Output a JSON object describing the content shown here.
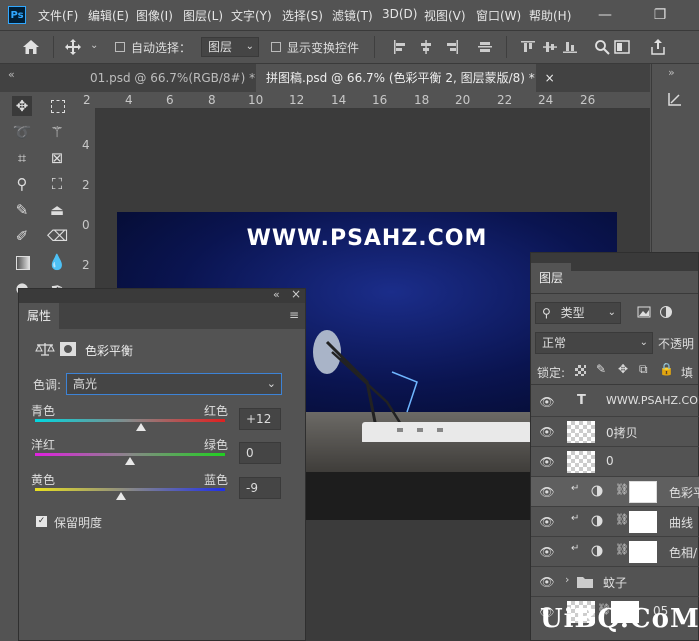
{
  "menubar": {
    "logo": "Ps",
    "items": [
      "文件(F)",
      "编辑(E)",
      "图像(I)",
      "图层(L)",
      "文字(Y)",
      "选择(S)",
      "滤镜(T)",
      "3D(D)",
      "视图(V)",
      "窗口(W)",
      "帮助(H)"
    ],
    "minimize": "—",
    "restore": "❐"
  },
  "options": {
    "auto_select_label": "自动选择：",
    "auto_select_value": "图层",
    "show_transform_label": "显示变换控件"
  },
  "tabs": [
    {
      "label": "01.psd @ 66.7%(RGB/8#) *",
      "close": "×"
    },
    {
      "label": "拼图稿.psd @ 66.7% (色彩平衡 2, 图层蒙版/8) *",
      "close": "×"
    }
  ],
  "tab_menu": "«",
  "ruler": {
    "top": [
      "2",
      "4",
      "6",
      "8",
      "10",
      "12",
      "14",
      "16",
      "18",
      "20",
      "22",
      "24",
      "26"
    ],
    "left": [
      "4",
      "2",
      "0",
      "2",
      "4"
    ]
  },
  "canvas": {
    "text": "WWW.PSAHZ.COM"
  },
  "properties": {
    "title": "属性",
    "collapse": "«",
    "close": "×",
    "adjustment_title": "色彩平衡",
    "tone_label": "色调:",
    "tone_value": "高光",
    "sliders": [
      {
        "left": "青色",
        "right": "红色",
        "value": "+12",
        "level": 0.56
      },
      {
        "left": "洋红",
        "right": "绿色",
        "value": "0",
        "level": 0.5
      },
      {
        "left": "黄色",
        "right": "蓝色",
        "value": "-9",
        "level": 0.45
      }
    ],
    "preserve_luminosity": "保留明度"
  },
  "layers": {
    "title": "图层",
    "filter_type": "类型",
    "blend_mode": "正常",
    "opacity_label": "不透明",
    "lock_label": "锁定:",
    "fill_label": "填",
    "rows": [
      {
        "type": "text",
        "name": "WWW.PSAHZ.COM"
      },
      {
        "type": "pixel",
        "name": "0拷贝"
      },
      {
        "type": "pixel",
        "name": "0"
      },
      {
        "type": "adjust",
        "name": "色彩平"
      },
      {
        "type": "adjust",
        "name": "曲线"
      },
      {
        "type": "adjust",
        "name": "色相/"
      },
      {
        "type": "group",
        "name": "蚊子"
      },
      {
        "type": "pixel-mask",
        "name": "05"
      }
    ]
  },
  "watermark": "UiBQ.CoM"
}
